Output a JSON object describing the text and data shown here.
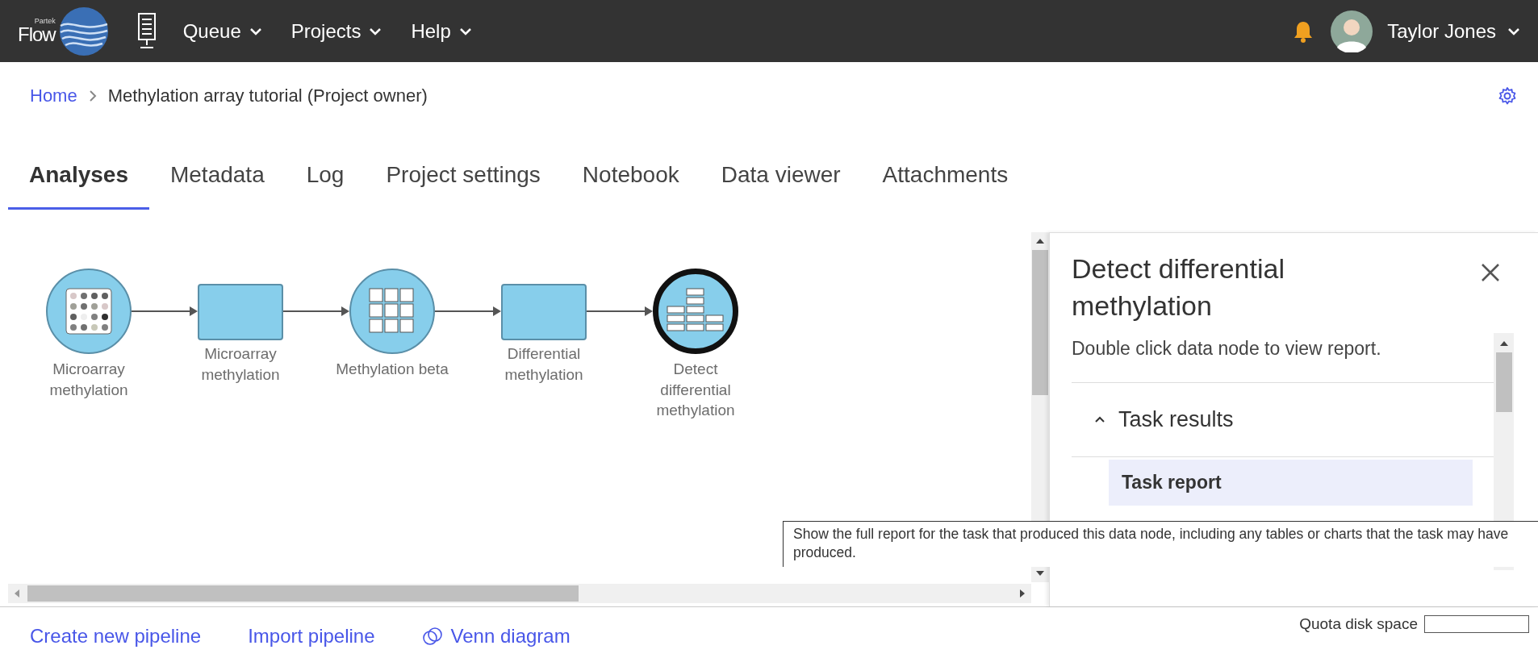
{
  "header": {
    "logo": {
      "maker": "Partek",
      "product": "Flow"
    },
    "menus": [
      {
        "label": "Queue"
      },
      {
        "label": "Projects"
      },
      {
        "label": "Help"
      }
    ],
    "user": {
      "name": "Taylor Jones"
    }
  },
  "breadcrumb": [
    {
      "kind": "link",
      "label": "Home"
    },
    {
      "kind": "current",
      "label": "Methylation array tutorial (Project owner)"
    }
  ],
  "tabs": [
    {
      "label": "Analyses",
      "selected": true
    },
    {
      "label": "Metadata",
      "selected": false
    },
    {
      "label": "Log",
      "selected": false
    },
    {
      "label": "Project settings",
      "selected": false
    },
    {
      "label": "Notebook",
      "selected": false
    },
    {
      "label": "Data viewer",
      "selected": false
    },
    {
      "label": "Attachments",
      "selected": false
    }
  ],
  "pipeline": {
    "nodes": [
      {
        "kind": "matrix",
        "label": "Microarray methylation",
        "selected": false
      },
      {
        "kind": "task",
        "label": "Microarray methylation",
        "selected": false
      },
      {
        "kind": "grid",
        "label": "Methylation beta",
        "selected": false
      },
      {
        "kind": "task",
        "label": "Differential methylation",
        "selected": false
      },
      {
        "kind": "stack",
        "label": "Detect differential methylation",
        "selected": true
      }
    ]
  },
  "panel": {
    "title": "Detect differential methylation",
    "hint": "Double click data node to view report.",
    "section": {
      "label": "Task results",
      "expanded": true
    },
    "items": [
      {
        "label": "Task report",
        "selected": true
      }
    ]
  },
  "tooltip": {
    "text": "Show the full report for the task that produced this data node, including any tables or charts that the task may have produced."
  },
  "footer": {
    "links": [
      {
        "kind": "plain",
        "label": "Create new pipeline"
      },
      {
        "kind": "plain",
        "label": "Import pipeline"
      },
      {
        "kind": "venn",
        "label": "Venn diagram"
      }
    ],
    "quota": {
      "label": "Quota disk space"
    }
  }
}
